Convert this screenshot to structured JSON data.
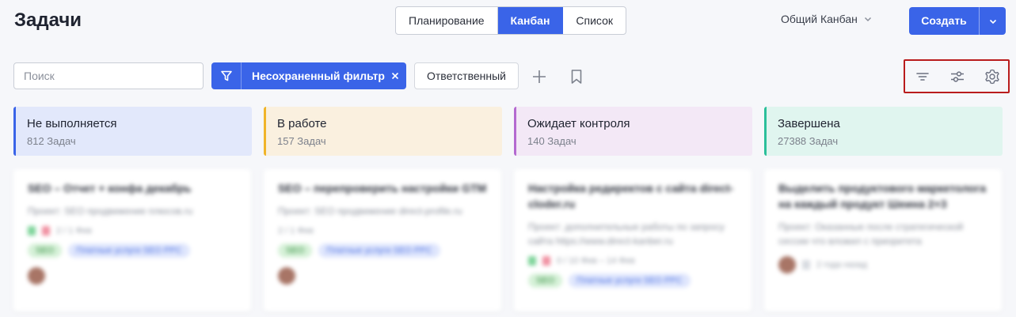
{
  "header": {
    "title": "Задачи",
    "tabs": [
      "Планирование",
      "Канбан",
      "Список"
    ],
    "active_tab": "Канбан",
    "board_selector": "Общий Канбан",
    "create_label": "Создать"
  },
  "toolbar": {
    "search_placeholder": "Поиск",
    "filter_label": "Несохраненный фильтр",
    "assignee_label": "Ответственный"
  },
  "columns": [
    {
      "name": "Не выполняется",
      "count": "812 Задач",
      "accent": "#3a64e8",
      "bg": "#e2e8fb"
    },
    {
      "name": "В работе",
      "count": "157 Задач",
      "accent": "#f0b429",
      "bg": "#faf0df"
    },
    {
      "name": "Ожидает контроля",
      "count": "140 Задач",
      "accent": "#b46ad0",
      "bg": "#f3e8f6"
    },
    {
      "name": "Завершена",
      "count": "27388 Задач",
      "accent": "#2bbf9a",
      "bg": "#e0f5ef"
    }
  ],
  "cards": [
    {
      "title": "SEO – Отчет + конфа декабрь",
      "sub": "Проект: SEO продвижение плюсов.ru",
      "meta": "2 / 1 Фев",
      "tag1": "SEO",
      "tag2": "Платные услуги SEO PPC"
    },
    {
      "title": "SEO – перепроверить настройки GTM",
      "sub": "Проект: SEO продвижение direct-profile.ru",
      "meta": "2 / 1 Фев",
      "tag1": "SEO",
      "tag2": "Платные услуги SEO PPC"
    },
    {
      "title": "Настройка редиректов с сайта direct-cloder.ru",
      "sub": "Проект: дополнительные работы по запросу сайта https://www.direct-kanber.ru",
      "meta": "0 / 10 Фев – 14 Фев",
      "tag1": "SEO",
      "tag2": "Платные услуги SEO PPC"
    },
    {
      "title": "Выделить продуктового маркетолога на каждый продукт Шеина 2+3",
      "sub": "Проект: Оказанные после стратегической сессии что вложил с приоритета",
      "meta": "2 года назад",
      "tag1": "",
      "tag2": ""
    }
  ],
  "colors": {
    "primary": "#3a64e8",
    "highlight_border": "#b91c1c"
  },
  "icons": {
    "filter_icon": "funnel-icon",
    "tools": [
      "sort-lines-icon",
      "sliders-icon",
      "gear-icon"
    ]
  }
}
